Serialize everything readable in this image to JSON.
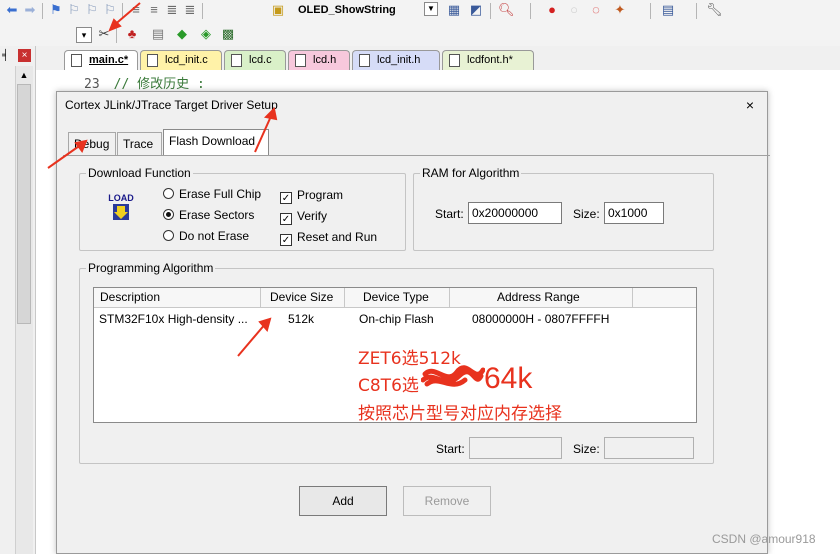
{
  "toolbar": {
    "target_combo": "OLED_ShowString",
    "icons1": [
      "back-arrow-icon",
      "forward-arrow-icon",
      "bookmark-icon",
      "bookmark-prev-icon",
      "bookmark-next-icon",
      "bookmark-clear-icon",
      "indent-icon",
      "unindent-icon",
      "comment-icon",
      "uncomment-icon",
      "find-icon"
    ],
    "icons2": [
      "translate-icon",
      "build-icon",
      "rebuild-icon",
      "batch-icon",
      "download-icon",
      "options-icon"
    ]
  },
  "editor": {
    "tabs": [
      {
        "label": "main.c*",
        "active": true,
        "color": "#ffffff"
      },
      {
        "label": "lcd_init.c",
        "active": false,
        "color": "#fff2a8"
      },
      {
        "label": "lcd.c",
        "active": false,
        "color": "#d9f0c8"
      },
      {
        "label": "lcd.h",
        "active": false,
        "color": "#f7c8dc"
      },
      {
        "label": "lcd_init.h",
        "active": false,
        "color": "#d6dcf7"
      },
      {
        "label": "lcdfont.h*",
        "active": false,
        "color": "#e8f2d4"
      }
    ],
    "line_number": "23",
    "line_text": "// 修改历史    :"
  },
  "dialog": {
    "title": "Cortex JLink/JTrace Target Driver Setup",
    "close": "×",
    "tabs": [
      "Debug",
      "Trace",
      "Flash Download"
    ],
    "selected_tab": "Flash Download",
    "download_function": {
      "label": "Download Function",
      "icon_text": "LOAD",
      "radios": [
        {
          "label": "Erase Full Chip",
          "checked": false
        },
        {
          "label": "Erase Sectors",
          "checked": true
        },
        {
          "label": "Do not Erase",
          "checked": false
        }
      ],
      "checks": [
        {
          "label": "Program",
          "checked": true
        },
        {
          "label": "Verify",
          "checked": true
        },
        {
          "label": "Reset and Run",
          "checked": true
        }
      ]
    },
    "ram": {
      "label": "RAM for Algorithm",
      "start_label": "Start:",
      "start_value": "0x20000000",
      "size_label": "Size:",
      "size_value": "0x1000"
    },
    "programming": {
      "label": "Programming Algorithm",
      "columns": [
        "Description",
        "Device Size",
        "Device Type",
        "Address Range"
      ],
      "rows": [
        {
          "description": "STM32F10x High-density ...",
          "size": "512k",
          "type": "On-chip Flash",
          "range": "08000000H - 0807FFFFH"
        }
      ],
      "start_label": "Start:",
      "size_label": "Size:"
    },
    "buttons": {
      "add": "Add",
      "remove": "Remove"
    }
  },
  "annotations": {
    "line1": "ZET6选512k",
    "line2_prefix": "C8T6选",
    "line2_big": "64k",
    "line3": "按照芯片型号对应内存选择",
    "color": "#e8321e"
  },
  "watermark": "CSDN @amour918"
}
